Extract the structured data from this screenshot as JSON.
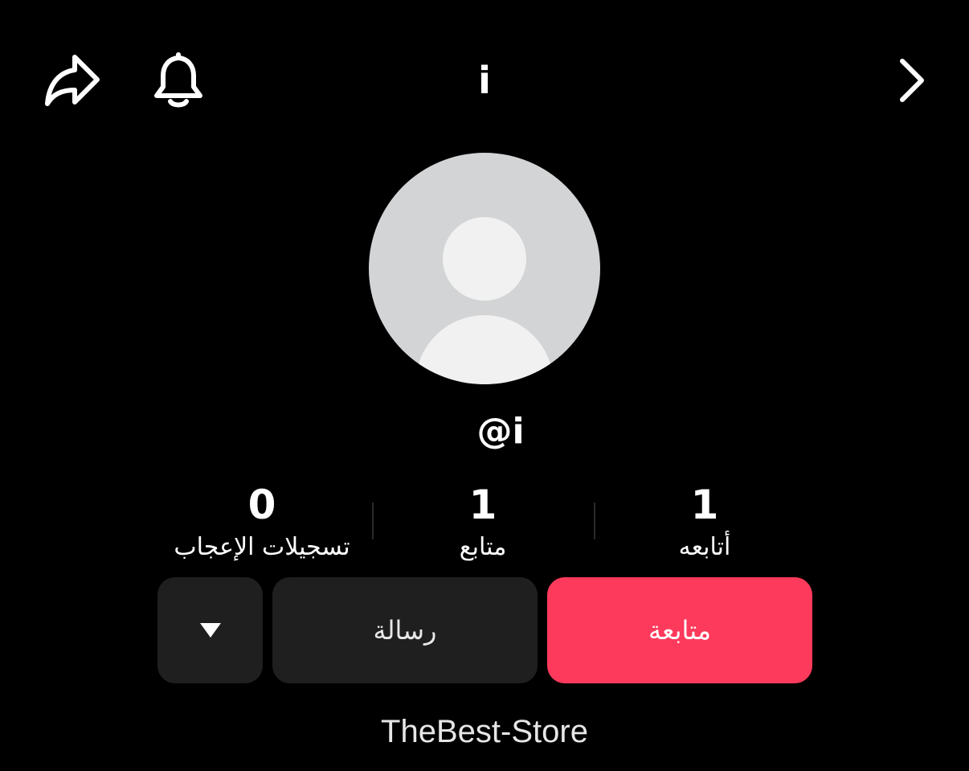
{
  "header": {
    "title": "i",
    "share_icon": "share-arrow-icon",
    "bell_icon": "bell-icon",
    "forward_icon": "chevron-right-icon"
  },
  "profile": {
    "avatar_icon": "default-avatar-icon",
    "handle": "@i"
  },
  "stats": {
    "likes": {
      "value": "0",
      "label": "تسجيلات الإعجاب"
    },
    "followers": {
      "value": "1",
      "label": "متابع"
    },
    "following": {
      "value": "1",
      "label": "أتابعه"
    }
  },
  "actions": {
    "more_icon": "caret-down-icon",
    "message_label": "رسالة",
    "follow_label": "متابعة"
  },
  "bio": {
    "text": "TheBest-Store"
  },
  "colors": {
    "background": "#000000",
    "follow_button": "#fe3a5c",
    "secondary_button": "#1f1f1f",
    "avatar_bg": "#d2d4d5"
  }
}
